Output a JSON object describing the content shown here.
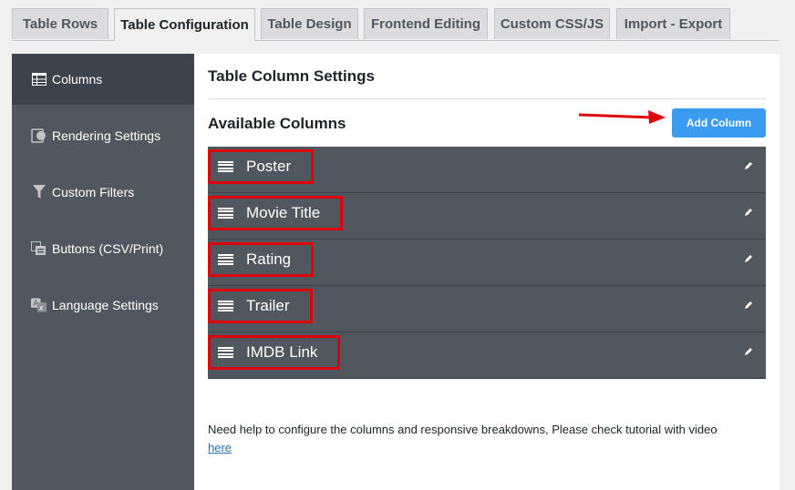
{
  "tabs": [
    {
      "label": "Table Rows",
      "active": false
    },
    {
      "label": "Table Configuration",
      "active": true
    },
    {
      "label": "Table Design",
      "active": false
    },
    {
      "label": "Frontend Editing",
      "active": false
    },
    {
      "label": "Custom CSS/JS",
      "active": false
    },
    {
      "label": "Import - Export",
      "active": false
    }
  ],
  "sidebar": {
    "items": [
      {
        "label": "Columns",
        "icon": "table-icon",
        "active": true
      },
      {
        "label": "Rendering Settings",
        "icon": "rendering-icon",
        "active": false
      },
      {
        "label": "Custom Filters",
        "icon": "filter-icon",
        "active": false
      },
      {
        "label": "Buttons (CSV/Print)",
        "icon": "buttons-icon",
        "active": false
      },
      {
        "label": "Language Settings",
        "icon": "translation-icon",
        "active": false
      }
    ]
  },
  "main": {
    "title": "Table Column Settings",
    "available_title": "Available Columns",
    "add_button": "Add Column",
    "columns": [
      "Poster",
      "Movie Title",
      "Rating",
      "Trailer",
      "IMDB Link"
    ],
    "help_text": "Need help to configure the columns and responsive breakdowns, Please check tutorial with video",
    "help_link": "here"
  },
  "colors": {
    "accent": "#3a9bf0",
    "sidebar": "#50575e",
    "highlight": "#e0000a"
  }
}
